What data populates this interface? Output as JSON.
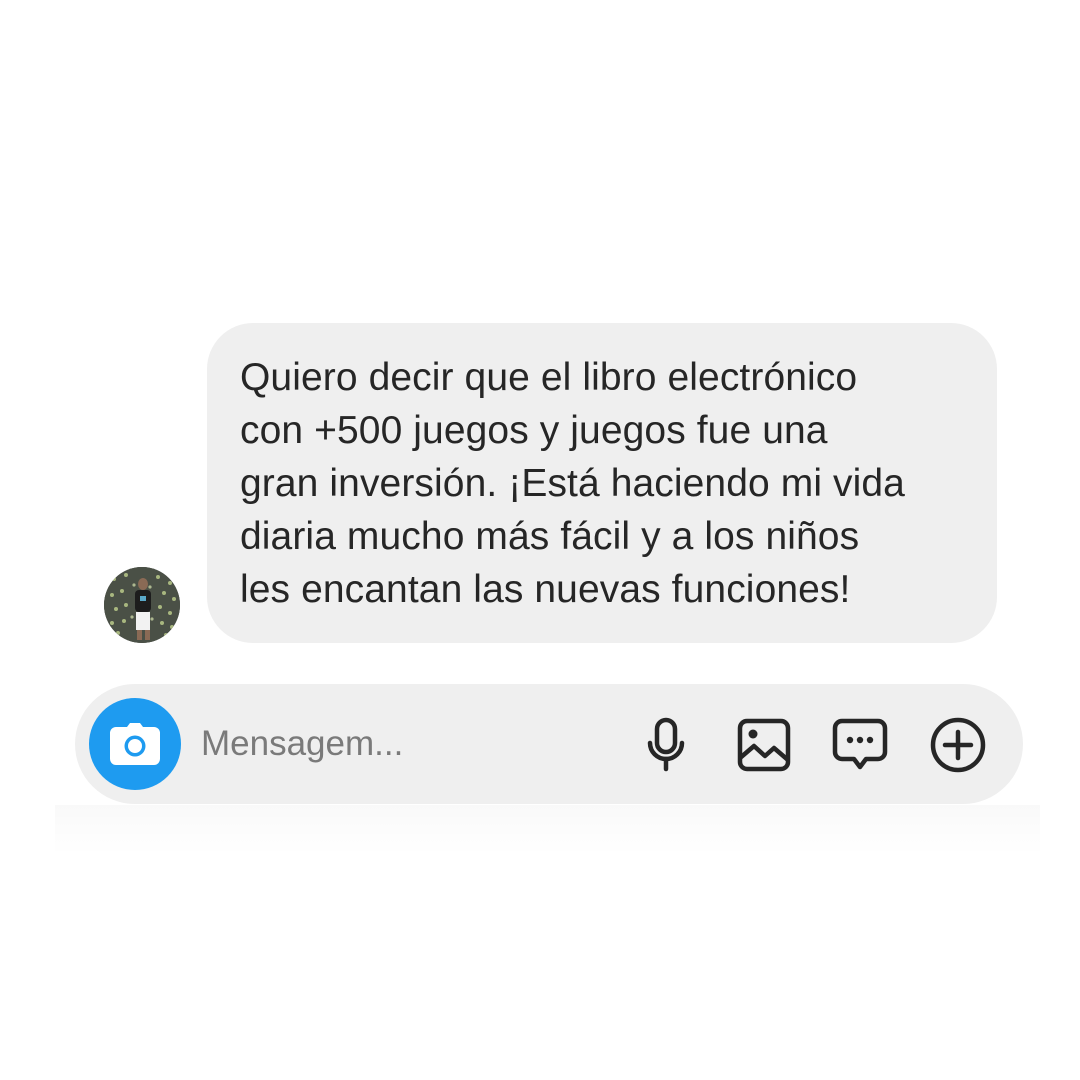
{
  "thread": {
    "message": {
      "text": "Quiero decir que el libro electrónico\ncon +500 juegos y juegos fue una\ngran inversión. ¡Está haciendo mi vida\ndiaria mucho más fácil y a los niños\nles encantan las nuevas funciones!",
      "bubble_color": "#efefef",
      "avatar_icon": "profile-photo"
    }
  },
  "composer": {
    "placeholder": "Mensagem...",
    "value": "",
    "camera_icon": "camera-icon",
    "accent": "#1e9bf0",
    "actions": [
      {
        "icon": "microphone-icon"
      },
      {
        "icon": "image-icon"
      },
      {
        "icon": "sticker-icon"
      },
      {
        "icon": "add-icon"
      }
    ]
  }
}
